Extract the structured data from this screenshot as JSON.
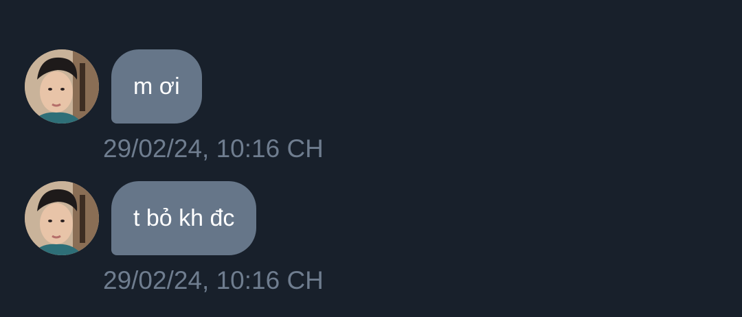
{
  "chat": {
    "messages": [
      {
        "text": "m ơi",
        "timestamp": "29/02/24, 10:16 CH"
      },
      {
        "text": "t bỏ kh đc",
        "timestamp": "29/02/24, 10:16 CH"
      }
    ]
  },
  "colors": {
    "background": "#18202b",
    "bubble": "#667689",
    "bubble_text": "#ffffff",
    "timestamp_text": "#6f7d8f"
  }
}
